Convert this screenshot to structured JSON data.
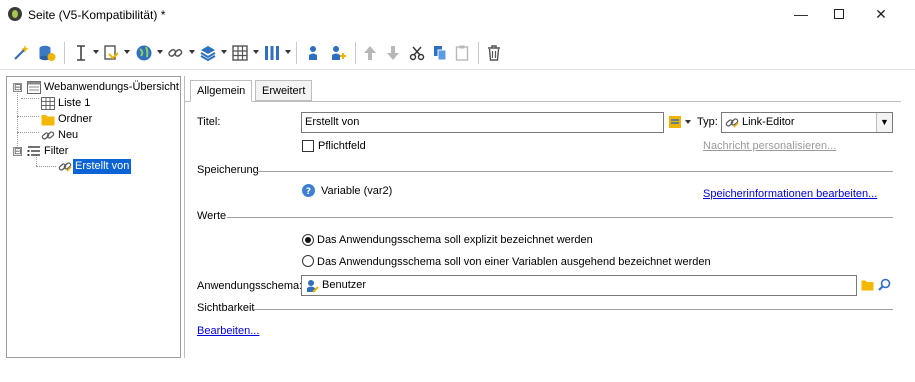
{
  "window": {
    "title": "Seite (V5-Kompatibilität) *",
    "minimize_glyph": "—",
    "close_glyph": "✕"
  },
  "tree": {
    "items": [
      {
        "label": "Webanwendungs-Übersicht",
        "icon": "web-app-overview-icon",
        "expander": "⊟"
      },
      {
        "label": "Liste 1",
        "icon": "grid-list-icon"
      },
      {
        "label": "Ordner",
        "icon": "folder-icon"
      },
      {
        "label": "Neu",
        "icon": "link-icon"
      },
      {
        "label": "Filter",
        "icon": "filter-list-icon",
        "expander": "⊟"
      },
      {
        "label": "Erstellt von",
        "icon": "link-editor-icon",
        "selected": true
      }
    ]
  },
  "tabs": [
    {
      "label": "Allgemein",
      "active": true
    },
    {
      "label": "Erweitert",
      "active": false
    }
  ],
  "form": {
    "title_label": "Titel:",
    "title_value": "Erstellt von",
    "type_label": "Typ:",
    "type_value": "Link-Editor",
    "required_label": "Pflichtfeld",
    "required_checked": false,
    "personalize_link": "Nachricht personalisieren...",
    "storage_section": "Speicherung",
    "variable_text": "Variable (var2)",
    "edit_storage_link": "Speicherinformationen bearbeiten...",
    "values_section": "Werte",
    "radio_explicit": "Das Anwendungsschema soll explizit bezeichnet werden",
    "radio_variable": "Das Anwendungsschema soll von einer Variablen ausgehend bezeichnet werden",
    "radio_selected": "explicit",
    "schema_label": "Anwendungsschema:",
    "schema_value": "Benutzer",
    "visibility_section": "Sichtbarkeit",
    "edit_link": "Bearbeiten..."
  },
  "colors": {
    "selection": "#0a64d6",
    "link": "#0000d8",
    "folder": "#f5b800",
    "help": "#3d7fd1"
  }
}
